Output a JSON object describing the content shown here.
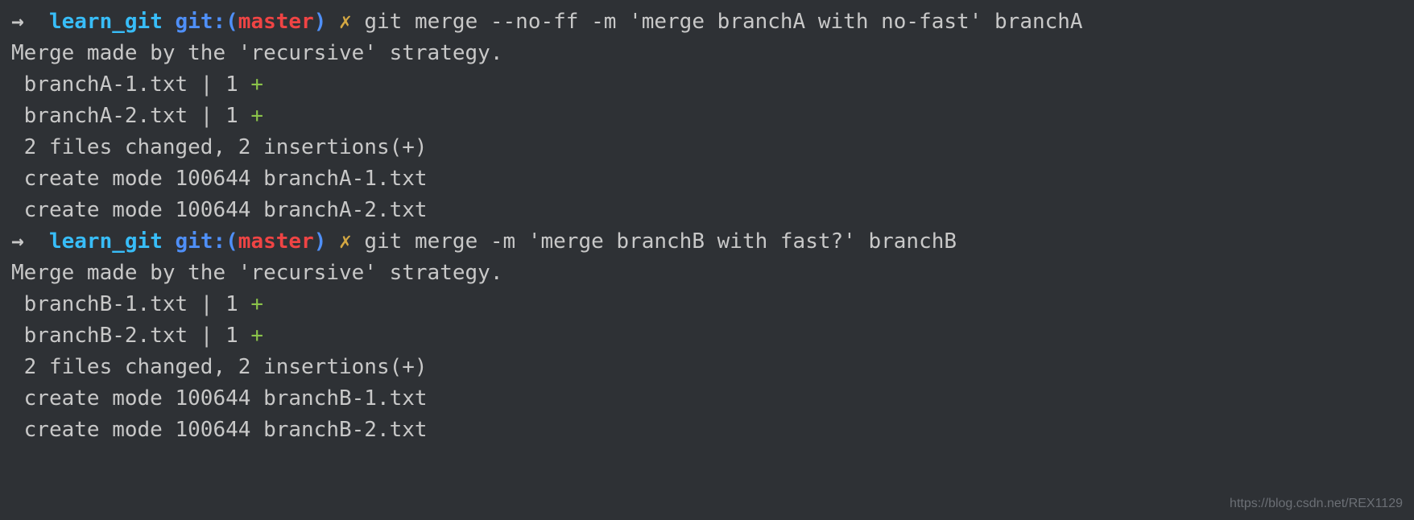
{
  "prompts": [
    {
      "arrow": "→",
      "dir": "learn_git",
      "git_label": "git:(",
      "branch": "master",
      "git_close": ")",
      "dirty": "✗",
      "command": "git merge --no-ff -m 'merge branchA with no-fast' branchA"
    },
    {
      "arrow": "→",
      "dir": "learn_git",
      "git_label": "git:(",
      "branch": "master",
      "git_close": ")",
      "dirty": "✗",
      "command": "git merge -m 'merge branchB with fast?' branchB"
    }
  ],
  "outputs": [
    {
      "strategy": "Merge made by the 'recursive' strategy.",
      "files": [
        {
          "name": " branchA-1.txt | 1 ",
          "plus": "+"
        },
        {
          "name": " branchA-2.txt | 1 ",
          "plus": "+"
        }
      ],
      "summary": " 2 files changed, 2 insertions(+)",
      "creates": [
        " create mode 100644 branchA-1.txt",
        " create mode 100644 branchA-2.txt"
      ]
    },
    {
      "strategy": "Merge made by the 'recursive' strategy.",
      "files": [
        {
          "name": " branchB-1.txt | 1 ",
          "plus": "+"
        },
        {
          "name": " branchB-2.txt | 1 ",
          "plus": "+"
        }
      ],
      "summary": " 2 files changed, 2 insertions(+)",
      "creates": [
        " create mode 100644 branchB-1.txt",
        " create mode 100644 branchB-2.txt"
      ]
    }
  ],
  "watermark": "https://blog.csdn.net/REX1129"
}
